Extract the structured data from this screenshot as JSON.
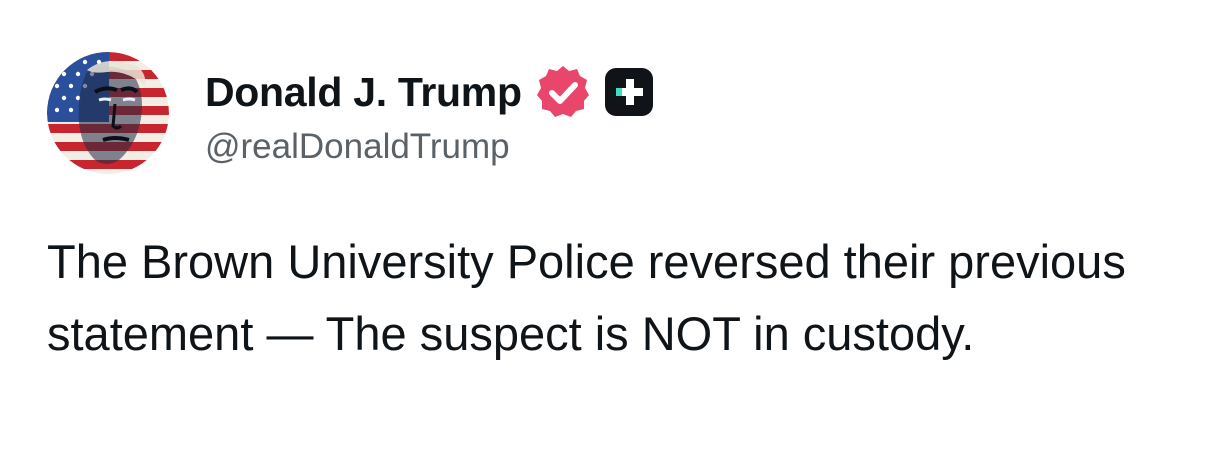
{
  "author": {
    "display_name": "Donald J. Trump",
    "handle": "@realDonaldTrump",
    "avatar_icon": "flag-portrait-avatar",
    "verified_icon": "verified-badge-icon",
    "verified_color": "#e8476b",
    "plus_badge_icon": "plus-badge-icon",
    "plus_badge_color": "#101418",
    "plus_accent_color": "#3ee0c0"
  },
  "post": {
    "text": "The Brown University Police reversed their previous statement — The suspect is NOT in custody."
  },
  "colors": {
    "text_primary": "#0f1419",
    "text_secondary": "#5a6268",
    "background": "#ffffff"
  }
}
